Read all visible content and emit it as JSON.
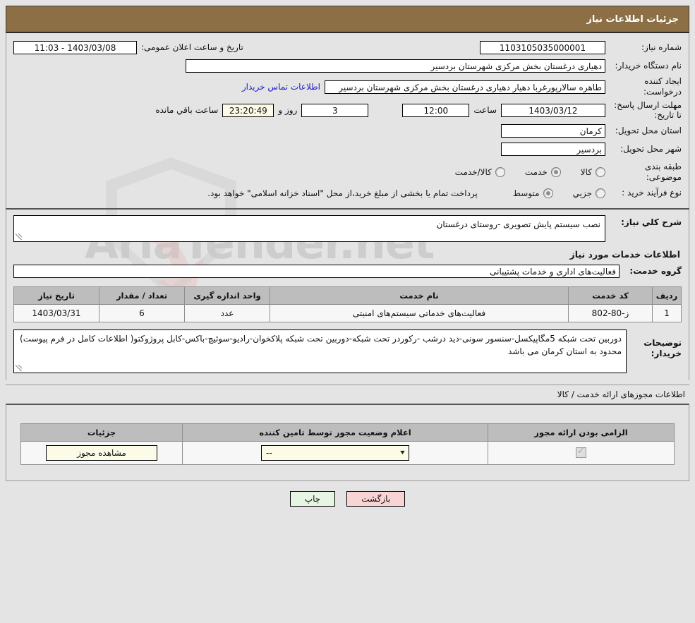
{
  "header": {
    "title": "جزئیات اطلاعات نیاز"
  },
  "form": {
    "need_number_label": "شماره نیاز:",
    "need_number_value": "1103105035000001",
    "announce_label": "تاریخ و ساعت اعلان عمومی:",
    "announce_value": "1403/03/08 - 11:03",
    "buyer_org_label": "نام دستگاه خریدار:",
    "buyer_org_value": "دهیاری درغستان بخش مرکزی شهرستان بردسیر",
    "requester_label": "ایجاد کننده درخواست:",
    "requester_value": "طاهره سالارپورغربا دهیار دهیاری درغستان بخش مرکزی شهرستان بردسیر",
    "contact_link": "اطلاعات تماس خریدار",
    "deadline_label": "مهلت ارسال پاسخ: تا تاریخ:",
    "deadline_date": "1403/03/12",
    "hour_label": "ساعت",
    "hour_value": "12:00",
    "days_value": "3",
    "days_label": "روز و",
    "countdown_value": "23:20:49",
    "remaining_label": "ساعت باقي مانده",
    "province_label": "استان محل تحویل:",
    "province_value": "کرمان",
    "city_label": "شهر محل تحویل:",
    "city_value": "بردسیر",
    "category_label": "طبقه بندی موضوعی:",
    "category_options": [
      {
        "label": "کالا",
        "selected": false
      },
      {
        "label": "خدمت",
        "selected": true
      },
      {
        "label": "کالا/خدمت",
        "selected": false
      }
    ],
    "process_label": "نوع فرآیند خرید :",
    "process_options": [
      {
        "label": "جزیي",
        "selected": false
      },
      {
        "label": "متوسط",
        "selected": true
      }
    ],
    "payment_note": "پرداخت تمام یا بخشی از مبلغ خرید،از محل \"اسناد خزانه اسلامی\" خواهد بود."
  },
  "summary": {
    "label": "شرح کلي نياز:",
    "value": "نصب سیستم پایش تصویری -روستای درغستان"
  },
  "services_section": {
    "heading": "اطلاعات خدمات مورد نیاز",
    "group_label": "گروه خدمت:",
    "group_value": "فعالیت‌های اداری و خدمات پشتیبانی",
    "columns": [
      "ردیف",
      "کد خدمت",
      "نام خدمت",
      "واحد اندازه گیری",
      "تعداد / مقدار",
      "تاریخ نیاز"
    ],
    "rows": [
      {
        "index": "1",
        "code": "ز-80-802",
        "name": "فعالیت‌های خدماتی سیستم‌های امنیتی",
        "unit": "عدد",
        "quantity": "6",
        "need_date": "1403/03/31"
      }
    ]
  },
  "buyer_notes": {
    "label": "توضیحات خریدار:",
    "value": "دوربین تحت شبکه 5مگاپیکسل-سنسور سونی-دید درشب -رکوردر تحت شبکه-دوربین تحت شبکه پلاکخوان-رادیو-سوئیچ-باکس-کابل پروژوکتو( اطلاعات کامل در فرم پیوست) محدود به استان کرمان می باشد"
  },
  "permits": {
    "title": "اطلاعات مجوزهای ارائه خدمت / کالا",
    "columns": [
      "الزامی بودن ارائه مجوز",
      "اعلام وضعیت مجوز توسط تامین کننده",
      "جزئیات"
    ],
    "rows": [
      {
        "required_checked": true,
        "status_value": "--",
        "detail_button": "مشاهده مجوز"
      }
    ]
  },
  "footer": {
    "back_label": "بازگشت",
    "print_label": "چاپ"
  },
  "watermark": {
    "text": "AriaTender.net"
  }
}
